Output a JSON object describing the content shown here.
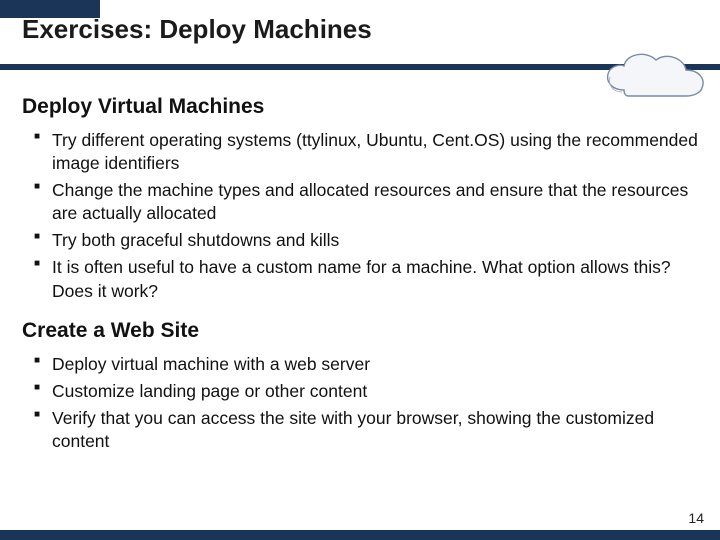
{
  "title": "Exercises: Deploy Machines",
  "page_number": "14",
  "sections": [
    {
      "heading": "Deploy Virtual Machines",
      "bullets": [
        "Try different operating systems (ttylinux, Ubuntu, Cent.OS) using the recommended image identifiers",
        "Change the machine types and allocated resources and ensure that the resources are actually allocated",
        "Try both graceful shutdowns and kills",
        "It is often useful to have a custom name for a machine.  What option allows this?  Does it work?"
      ]
    },
    {
      "heading": "Create a Web Site",
      "bullets": [
        "Deploy virtual machine with a web server",
        "Customize landing page or other content",
        "Verify that you can access the site with your browser, showing the customized content"
      ]
    }
  ]
}
